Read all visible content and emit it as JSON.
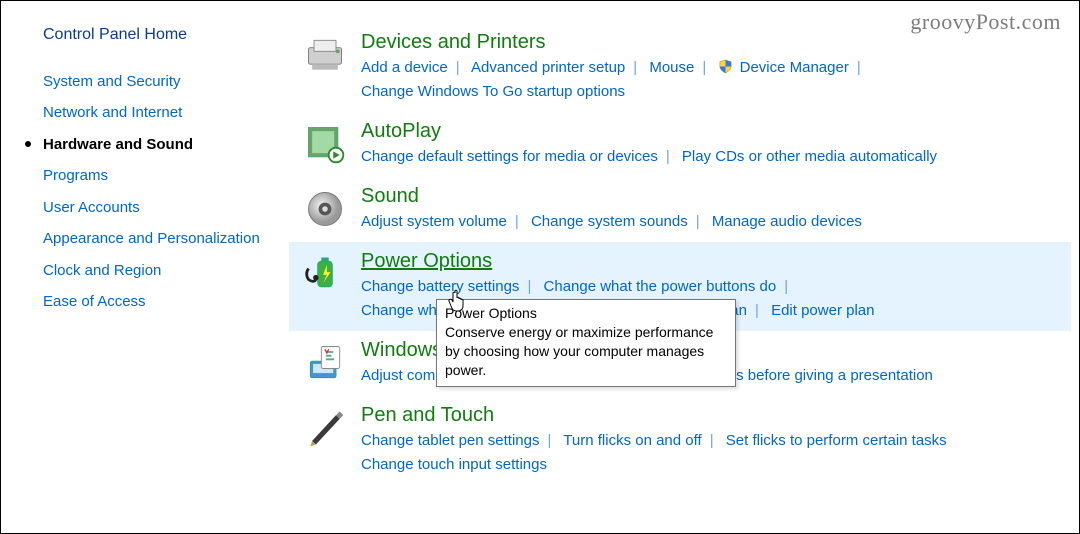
{
  "watermark": "groovyPost.com",
  "sidebar": {
    "home": "Control Panel Home",
    "items": [
      {
        "label": "System and Security"
      },
      {
        "label": "Network and Internet"
      },
      {
        "label": "Hardware and Sound"
      },
      {
        "label": "Programs"
      },
      {
        "label": "User Accounts"
      },
      {
        "label": "Appearance and Personalization"
      },
      {
        "label": "Clock and Region"
      },
      {
        "label": "Ease of Access"
      }
    ]
  },
  "categories": {
    "devices": {
      "title": "Devices and Printers",
      "links": {
        "add": "Add a device",
        "aps": "Advanced printer setup",
        "mouse": "Mouse",
        "devmgr": "Device Manager",
        "wtg": "Change Windows To Go startup options"
      }
    },
    "autoplay": {
      "title": "AutoPlay",
      "links": {
        "defaults": "Change default settings for media or devices",
        "playcd": "Play CDs or other media automatically"
      }
    },
    "sound": {
      "title": "Sound",
      "links": {
        "volume": "Adjust system volume",
        "sounds": "Change system sounds",
        "audio": "Manage audio devices"
      }
    },
    "power": {
      "title": "Power Options",
      "links": {
        "battery": "Change battery settings",
        "buttons": "Change what the power buttons do",
        "lid": "Change what closing the lid does",
        "choose": "Choose a power plan",
        "edit": "Edit power plan"
      }
    },
    "mobility": {
      "title": "Windows Mobility Center",
      "links": {
        "common": "Adjust commonly used mobility settings",
        "present": "Adjust settings before giving a presentation"
      }
    },
    "pen": {
      "title": "Pen and Touch",
      "links": {
        "tablet": "Change tablet pen settings",
        "flicks": "Turn flicks on and off",
        "setflicks": "Set flicks to perform certain tasks",
        "touch": "Change touch input settings"
      }
    }
  },
  "tooltip": {
    "title": "Power Options",
    "body": "Conserve energy or maximize performance by choosing how your computer manages power."
  }
}
